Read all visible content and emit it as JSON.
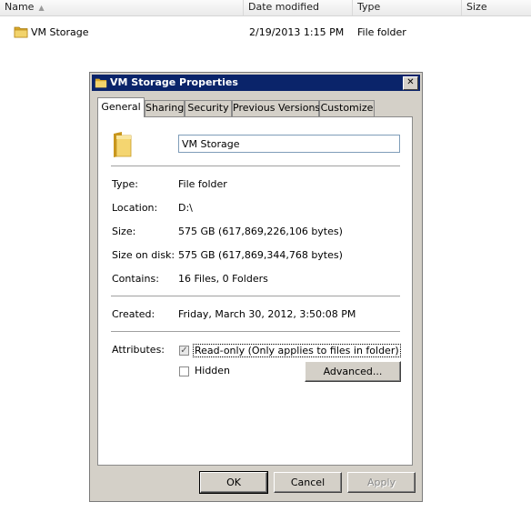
{
  "explorer": {
    "columns": {
      "name": "Name",
      "date_modified": "Date modified",
      "type": "Type",
      "size": "Size"
    },
    "rows": [
      {
        "name": "VM Storage",
        "date_modified": "2/19/2013 1:15 PM",
        "type": "File folder",
        "size": ""
      }
    ]
  },
  "dialog": {
    "title": "VM Storage Properties",
    "tabs": [
      "General",
      "Sharing",
      "Security",
      "Previous Versions",
      "Customize"
    ],
    "active_tab": "General",
    "general": {
      "folder_name": "VM Storage",
      "type_label": "Type:",
      "type_value": "File folder",
      "location_label": "Location:",
      "location_value": "D:\\",
      "size_label": "Size:",
      "size_value": "575 GB (617,869,226,106 bytes)",
      "size_on_disk_label": "Size on disk:",
      "size_on_disk_value": "575 GB (617,869,344,768 bytes)",
      "contains_label": "Contains:",
      "contains_value": "16 Files, 0 Folders",
      "created_label": "Created:",
      "created_value": "Friday, March 30, 2012, 3:50:08 PM",
      "attributes_label": "Attributes:",
      "readonly_label": "Read-only (Only applies to files in folder)",
      "readonly_checked": true,
      "hidden_label": "Hidden",
      "hidden_checked": false,
      "advanced_button": "Advanced..."
    },
    "buttons": {
      "ok": "OK",
      "cancel": "Cancel",
      "apply": "Apply"
    }
  },
  "colors": {
    "titlebar": "#0a246a",
    "dialog_face": "#d4d0c8",
    "folder": "#e8c14a"
  },
  "icons": [
    "folder-icon",
    "close-icon",
    "checkmark-icon",
    "sort-up-icon"
  ]
}
